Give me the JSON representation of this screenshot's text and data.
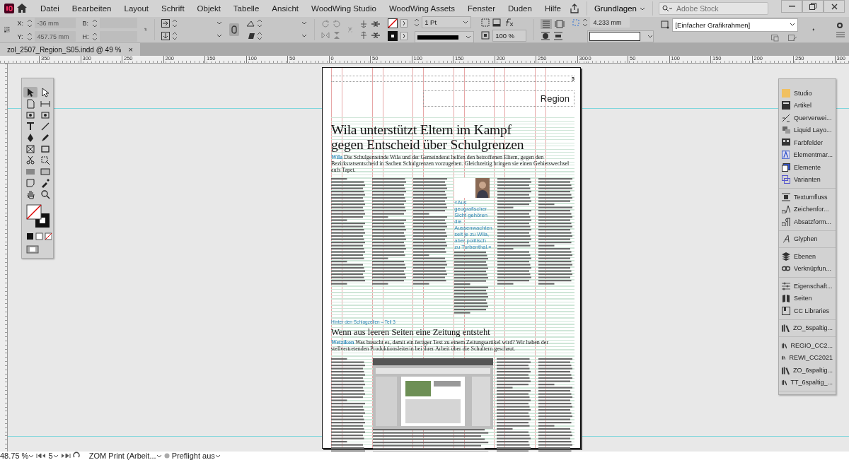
{
  "menu": [
    "Datei",
    "Bearbeiten",
    "Layout",
    "Schrift",
    "Objekt",
    "Tabelle",
    "Ansicht",
    "WoodWing Studio",
    "WoodWing Assets",
    "Fenster",
    "Duden",
    "Hilfe"
  ],
  "workspace": "Grundlagen",
  "search": {
    "placeholder": "Adobe Stock"
  },
  "control": {
    "x_label": "X:",
    "x": "-36 mm",
    "y_label": "Y:",
    "y": "457.75 mm",
    "w_label": "B:",
    "h_label": "H:",
    "stroke": "1 Pt",
    "scale": "100 %",
    "spacing": "4.233 mm",
    "object_style": "[Einfacher Grafikrahmen]"
  },
  "tab": {
    "title": "zol_2507_Region_S05.indd @ 49 %",
    "close": "×"
  },
  "ruler": [
    "350",
    "300",
    "250",
    "200",
    "150",
    "100",
    "50",
    "0",
    "50",
    "100",
    "150",
    "200",
    "250",
    "300",
    "0",
    "50",
    "100",
    "150",
    "200",
    "250",
    "300"
  ],
  "tools": [
    {
      "kind": "pointer",
      "selected": true
    },
    {
      "kind": "direct",
      "selected": false
    },
    {
      "kind": "page",
      "selected": false
    },
    {
      "kind": "gap",
      "selected": false
    },
    {
      "kind": "content",
      "selected": false
    },
    {
      "kind": "content",
      "selected": false
    },
    {
      "kind": "type",
      "selected": false
    },
    {
      "kind": "line",
      "selected": false
    },
    {
      "kind": "pen",
      "selected": false
    },
    {
      "kind": "pencil",
      "selected": false
    },
    {
      "kind": "frame",
      "selected": false
    },
    {
      "kind": "rect",
      "selected": false
    },
    {
      "kind": "scissors",
      "selected": false
    },
    {
      "kind": "transform",
      "selected": false
    },
    {
      "kind": "gradient",
      "selected": false
    },
    {
      "kind": "feather",
      "selected": false
    },
    {
      "kind": "note",
      "selected": false
    },
    {
      "kind": "eyedropper",
      "selected": false
    },
    {
      "kind": "hand",
      "selected": false
    },
    {
      "kind": "zoom",
      "selected": false
    }
  ],
  "page": {
    "folio": "5",
    "section": "Region",
    "article1": {
      "headline": "Wila unterstützt Eltern im Kampf gegen Entscheid über Schulgrenzen",
      "lead_place": "Wila",
      "lead": "Die Schulgemeinde Wila und der Gemeinderat helfen den betroffenen Eltern, gegen den Bezirksratsentscheid in Sachen Schulgrenzen vorzugehen. Gleichzeitig bringen sie einen Gebietswechsel aufs Tapet.",
      "quote": "«Aus geografischer Sicht gehören die Aussenwachten seit je zu Wila, aber politisch zu Turbenthal.»"
    },
    "article2": {
      "kicker": "Hinter den Schlagzeilen – Teil 3",
      "headline": "Wenn aus leeren Seiten eine Zeitung entsteht",
      "lead_place": "Wetzikon",
      "lead": "Was braucht es, damit ein fertiger Text zu einem Zeitungsartikel wird? Wir haben der stellvertretenden Produktionsleiterin bei ihrer Arbeit über die Schultern geschaut."
    }
  },
  "dock": [
    [
      {
        "label": "Studio",
        "kind": "studio"
      },
      {
        "label": "Artikel",
        "kind": "article"
      },
      {
        "label": "Querverwei...",
        "kind": "crossref"
      },
      {
        "label": "Liquid Layo...",
        "kind": "liquid"
      },
      {
        "label": "Farbfelder",
        "kind": "swatches"
      },
      {
        "label": "Elementmar...",
        "kind": "element"
      },
      {
        "label": "Elemente",
        "kind": "elements"
      },
      {
        "label": "Varianten",
        "kind": "variants"
      }
    ],
    [
      {
        "label": "Textumfluss",
        "kind": "wrap"
      },
      {
        "label": "Zeichenfor...",
        "kind": "charstyle"
      },
      {
        "label": "Absatzform...",
        "kind": "parastyle"
      }
    ],
    [
      {
        "label": "Glyphen",
        "kind": "glyphs"
      }
    ],
    [
      {
        "label": "Ebenen",
        "kind": "layers"
      },
      {
        "label": "Verknüpfun...",
        "kind": "links"
      }
    ],
    [
      {
        "label": "Eigenschaft...",
        "kind": "properties"
      },
      {
        "label": "Seiten",
        "kind": "pages"
      },
      {
        "label": "CC Libraries",
        "kind": "cclib"
      }
    ],
    [
      {
        "label": "ZO_5spaltig...",
        "kind": "library"
      }
    ],
    [
      {
        "label": "REGIO_CC2...",
        "kind": "library"
      },
      {
        "label": "REWI_CC2021",
        "kind": "library"
      },
      {
        "label": "ZO_6spaltig...",
        "kind": "library"
      },
      {
        "label": "TT_6spaltig_...",
        "kind": "library"
      }
    ]
  ],
  "status": {
    "zoom": "48.75 %",
    "page": "5",
    "profile": "ZOM Print (Arbeit...",
    "preflight": "Preflight aus"
  }
}
